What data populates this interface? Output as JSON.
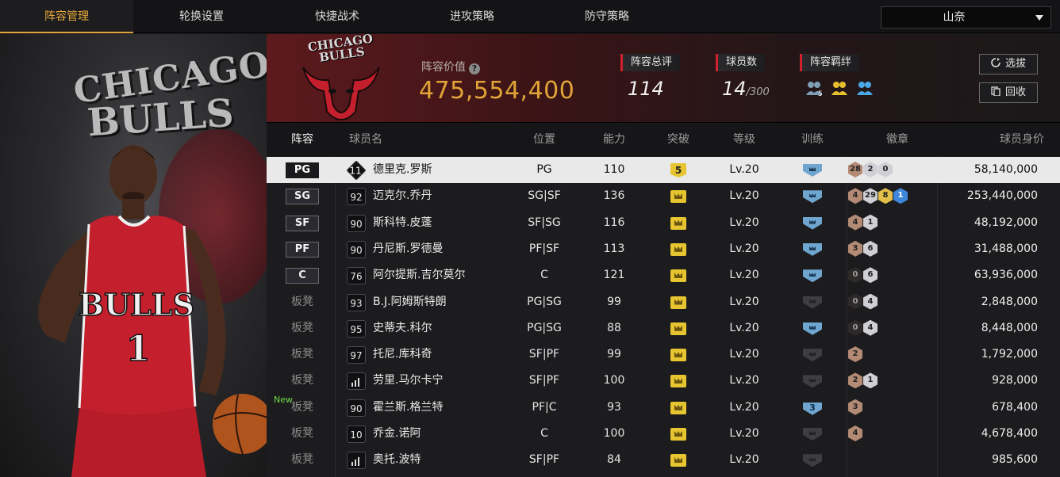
{
  "nav": {
    "tabs": [
      {
        "label": "阵容管理",
        "active": true
      },
      {
        "label": "轮换设置",
        "active": false
      },
      {
        "label": "快捷战术",
        "active": false
      },
      {
        "label": "进攻策略",
        "active": false
      },
      {
        "label": "防守策略",
        "active": false
      }
    ],
    "dropdown_value": "山奈"
  },
  "player_art": {
    "wordmark_top": "CHICAGO",
    "wordmark_bottom": "BULLS",
    "jersey_text": "BULLS",
    "jersey_number": "1"
  },
  "banner": {
    "logo_text_1": "CHICAGO",
    "logo_text_2": "BULLS",
    "value_label": "阵容价值",
    "value_help_icon": "?",
    "value": "475,554,400",
    "rating_label": "阵容总评",
    "rating": "114",
    "players_label": "球员数",
    "players_count": "14",
    "players_max": "/300",
    "bond_label": "阵容羁绊",
    "bond_icons": [
      "team-bond-icon-5",
      "team-bond-icon-gold",
      "team-bond-icon-blue"
    ],
    "bond_icon_num": "5",
    "pull_button": "选拔",
    "recycle_button": "回收"
  },
  "table": {
    "headers": [
      "阵容",
      "球员名",
      "位置",
      "能力",
      "突破",
      "等级",
      "训练",
      "徽章",
      "球员身价"
    ],
    "rows": [
      {
        "slot": "PG",
        "starter": true,
        "number": "11",
        "name": "德里克.罗斯",
        "pos": "PG",
        "ability": "110",
        "break": "5",
        "level": "Lv.20",
        "train": "on",
        "badges": [
          {
            "t": "bronze",
            "n": "28"
          },
          {
            "t": "silver",
            "n": "2"
          },
          {
            "t": "silver",
            "n": "0"
          }
        ],
        "salary": "58,140,000",
        "selected": true
      },
      {
        "slot": "SG",
        "starter": true,
        "number": "92",
        "name": "迈克尔.乔丹",
        "pos": "SG|SF",
        "ability": "136",
        "break": "",
        "level": "Lv.20",
        "train": "on",
        "badges": [
          {
            "t": "bronze",
            "n": "4"
          },
          {
            "t": "silver",
            "n": "29"
          },
          {
            "t": "gold",
            "n": "8"
          },
          {
            "t": "blue",
            "n": "1"
          }
        ],
        "salary": "253,440,000"
      },
      {
        "slot": "SF",
        "starter": true,
        "number": "90",
        "name": "斯科特.皮蓬",
        "pos": "SF|SG",
        "ability": "116",
        "break": "",
        "level": "Lv.20",
        "train": "on",
        "badges": [
          {
            "t": "bronze",
            "n": "4"
          },
          {
            "t": "silver",
            "n": "1"
          }
        ],
        "salary": "48,192,000"
      },
      {
        "slot": "PF",
        "starter": true,
        "number": "90",
        "name": "丹尼斯.罗德曼",
        "pos": "PF|SF",
        "ability": "113",
        "break": "",
        "level": "Lv.20",
        "train": "on",
        "badges": [
          {
            "t": "bronze",
            "n": "3"
          },
          {
            "t": "silver",
            "n": "6"
          }
        ],
        "salary": "31,488,000"
      },
      {
        "slot": "C",
        "starter": true,
        "number": "76",
        "name": "阿尔提斯.吉尔莫尔",
        "pos": "C",
        "ability": "121",
        "break": "",
        "level": "Lv.20",
        "train": "on",
        "badges": [
          {
            "t": "dark",
            "n": "0"
          },
          {
            "t": "silver",
            "n": "6"
          }
        ],
        "salary": "63,936,000"
      },
      {
        "slot": "板凳",
        "starter": false,
        "number": "93",
        "name": "B.J.阿姆斯特朗",
        "pos": "PG|SG",
        "ability": "99",
        "break": "",
        "level": "Lv.20",
        "train": "off",
        "badges": [
          {
            "t": "dark",
            "n": "0"
          },
          {
            "t": "silver",
            "n": "4"
          }
        ],
        "salary": "2,848,000"
      },
      {
        "slot": "板凳",
        "starter": false,
        "number": "95",
        "name": "史蒂夫.科尔",
        "pos": "PG|SG",
        "ability": "88",
        "break": "",
        "level": "Lv.20",
        "train": "on",
        "badges": [
          {
            "t": "dark",
            "n": "0"
          },
          {
            "t": "silver",
            "n": "4"
          }
        ],
        "salary": "8,448,000"
      },
      {
        "slot": "板凳",
        "starter": false,
        "number": "97",
        "name": "托尼.库科奇",
        "pos": "SF|PF",
        "ability": "99",
        "break": "",
        "level": "Lv.20",
        "train": "off",
        "badges": [
          {
            "t": "bronze",
            "n": "2"
          }
        ],
        "salary": "1,792,000"
      },
      {
        "slot": "板凳",
        "starter": false,
        "number": "",
        "bars": true,
        "name": "劳里.马尔卡宁",
        "pos": "SF|PF",
        "ability": "100",
        "break": "",
        "level": "Lv.20",
        "train": "off",
        "badges": [
          {
            "t": "bronze",
            "n": "2"
          },
          {
            "t": "silver",
            "n": "1"
          }
        ],
        "salary": "928,000"
      },
      {
        "slot": "板凳",
        "starter": false,
        "new": "New",
        "number": "90",
        "name": "霍兰斯.格兰特",
        "pos": "PF|C",
        "ability": "93",
        "break": "",
        "level": "Lv.20",
        "train": "3",
        "badges": [
          {
            "t": "bronze",
            "n": "3"
          }
        ],
        "salary": "678,400"
      },
      {
        "slot": "板凳",
        "starter": false,
        "number": "10",
        "name": "乔金.诺阿",
        "pos": "C",
        "ability": "100",
        "break": "",
        "level": "Lv.20",
        "train": "off",
        "badges": [
          {
            "t": "bronze",
            "n": "4"
          }
        ],
        "salary": "4,678,400"
      },
      {
        "slot": "板凳",
        "starter": false,
        "number": "",
        "bars": true,
        "name": "奥托.波特",
        "pos": "SF|PF",
        "ability": "84",
        "break": "",
        "level": "Lv.20",
        "train": "off",
        "badges": [],
        "salary": "985,600"
      }
    ]
  },
  "colors": {
    "accent_gold": "#e0a437",
    "ability_green": "#49b33a",
    "bulls_red": "#d0212c",
    "train_blue": "#6fa6cf"
  }
}
